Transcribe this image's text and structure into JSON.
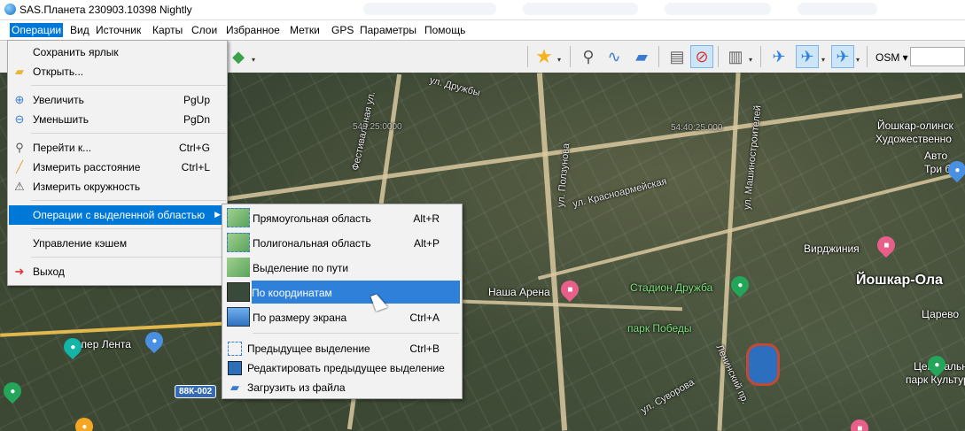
{
  "window": {
    "title": "SAS.Планета 230903.10398 Nightly"
  },
  "menubar": {
    "items": [
      "Операции",
      "Вид",
      "Источник",
      "Карты",
      "Слои",
      "Избранное",
      "Метки",
      "GPS",
      "Параметры",
      "Помощь"
    ]
  },
  "toolbar": {
    "map_source": "OSM"
  },
  "operations_menu": {
    "items": [
      {
        "label": "Сохранить ярлык",
        "shortcut": ""
      },
      {
        "label": "Открыть...",
        "shortcut": ""
      },
      {
        "label": "Увеличить",
        "shortcut": "PgUp"
      },
      {
        "label": "Уменьшить",
        "shortcut": "PgDn"
      },
      {
        "label": "Перейти к...",
        "shortcut": "Ctrl+G"
      },
      {
        "label": "Измерить расстояние",
        "shortcut": "Ctrl+L"
      },
      {
        "label": "Измерить окружность",
        "shortcut": ""
      },
      {
        "label": "Операции с выделенной областью",
        "shortcut": ""
      },
      {
        "label": "Управление кэшем",
        "shortcut": ""
      },
      {
        "label": "Выход",
        "shortcut": ""
      }
    ]
  },
  "selection_submenu": {
    "items": [
      {
        "label": "Прямоугольная область",
        "shortcut": "Alt+R"
      },
      {
        "label": "Полигональная область",
        "shortcut": "Alt+P"
      },
      {
        "label": "Выделение по пути",
        "shortcut": ""
      },
      {
        "label": "По координатам",
        "shortcut": ""
      },
      {
        "label": "По размеру экрана",
        "shortcut": "Ctrl+A"
      },
      {
        "label": "Предыдущее выделение",
        "shortcut": "Ctrl+B"
      },
      {
        "label": "Редактировать предыдущее выделение",
        "shortcut": ""
      },
      {
        "label": "Загрузить из файла",
        "shortcut": ""
      }
    ]
  },
  "map": {
    "labels": {
      "city": "Йошкар-Ола",
      "gallery_1": "Йошкар-олинск",
      "gallery_2": "Художественно",
      "avto": "Авто",
      "tri_bogatyrya": "Три бога",
      "virdzhiniya": "Вирджиния",
      "nasha_arena": "Наша Арена",
      "stadium": "Стадион Дружба",
      "park_pobedy": "парк Победы",
      "giper_lenta": "Гипер Лента",
      "tsarevo": "Царево",
      "central_park_1": "Центральный",
      "central_park_2": "парк Культуры",
      "street_druzhby": "ул. Дружбы",
      "street_festivalnaya": "Фестивальная ул.",
      "street_polzunova": "ул. Ползунова",
      "street_krasnoarmeyskaya": "ул. Красноармейская",
      "street_mashinostroiteley": "ул. Машиностроителей",
      "street_leninskiy": "Ленинский пр.",
      "street_suvorova": "ул. Суворова",
      "coord_1": "549:25:0000",
      "coord_2": "54:40:25.000",
      "route": "88К-002"
    }
  },
  "colors": {
    "accent": "#0078d7",
    "menu_bg": "#f2f2f2"
  }
}
